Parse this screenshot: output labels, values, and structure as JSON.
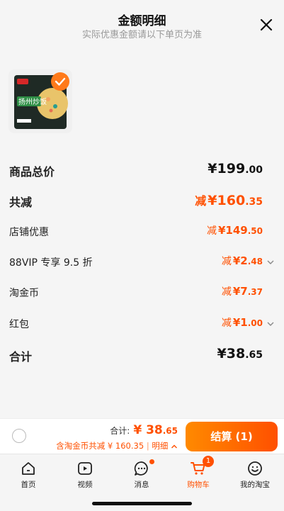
{
  "header": {
    "title": "金额明细",
    "subtitle": "实际优惠金额请以下单页为准"
  },
  "product": {
    "image_text": "扬州炒饭",
    "selected": true
  },
  "rows": [
    {
      "label": "商品总价",
      "prefix": "",
      "int": "¥199",
      "dec": ".00",
      "style": "big-dark"
    },
    {
      "label": "共减",
      "prefix": "减",
      "int": "¥160",
      "dec": ".35",
      "style": "big-orange"
    },
    {
      "label": "店铺优惠",
      "prefix": "减",
      "int": "¥149",
      "dec": ".50",
      "style": "med-orange"
    },
    {
      "label": "88VIP 专享 9.5 折",
      "prefix": "减",
      "int": "¥2",
      "dec": ".48",
      "style": "med-orange",
      "chevron": true
    },
    {
      "label": "淘金币",
      "prefix": "减",
      "int": "¥7",
      "dec": ".37",
      "style": "med-orange"
    },
    {
      "label": "红包",
      "prefix": "减",
      "int": "¥1",
      "dec": ".00",
      "style": "med-orange",
      "chevron": true
    },
    {
      "label": "合计",
      "prefix": "",
      "int": "¥38",
      "dec": ".65",
      "style": "big-dark"
    }
  ],
  "bottom": {
    "total_label": "合计:",
    "total_int": "¥ 38",
    "total_dec": ".65",
    "detail_text": "含淘金币共减 ¥ 160.35",
    "detail_sep": "|",
    "detail_link": "明细",
    "checkout_label": "结算 (1)"
  },
  "tabbar": {
    "items": [
      {
        "label": "首页",
        "icon": "home-icon"
      },
      {
        "label": "视频",
        "icon": "video-icon"
      },
      {
        "label": "消息",
        "icon": "message-icon"
      },
      {
        "label": "购物车",
        "icon": "cart-icon"
      },
      {
        "label": "我的淘宝",
        "icon": "profile-icon"
      }
    ],
    "cart_badge": "1"
  },
  "colors": {
    "accent": "#ff5000",
    "gradient_start": "#ff8a00",
    "background": "#f5f5f5"
  }
}
